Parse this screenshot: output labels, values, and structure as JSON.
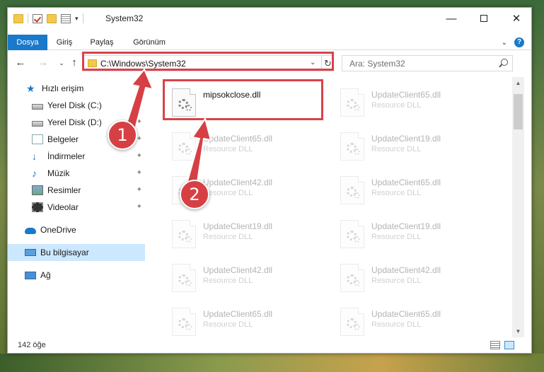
{
  "window": {
    "title": "System32",
    "qat_dropdown": "▾",
    "controls": {
      "minimize": "—",
      "maximize": "",
      "close": "✕"
    }
  },
  "ribbon": {
    "tabs": [
      "Dosya",
      "Giriş",
      "Paylaş",
      "Görünüm"
    ],
    "collapse": "⌄",
    "help": "?",
    "active_color": "#1979ca"
  },
  "nav": {
    "back": "←",
    "forward": "→",
    "recent": "⌄",
    "up": "↑",
    "address": "C:\\Windows\\System32",
    "address_dropdown": "⌄",
    "refresh": "↻",
    "search_placeholder": "Ara: System32"
  },
  "sidebar": {
    "items": [
      {
        "label": "Hızlı erişim",
        "icon": "star-icon",
        "pinned": false
      },
      {
        "label": "Yerel Disk (C:)",
        "icon": "drive-icon",
        "pinned": true
      },
      {
        "label": "Yerel Disk (D:)",
        "icon": "drive-icon",
        "pinned": true
      },
      {
        "label": "Belgeler",
        "icon": "documents-icon",
        "pinned": true
      },
      {
        "label": "İndirmeler",
        "icon": "downloads-icon",
        "pinned": true
      },
      {
        "label": "Müzik",
        "icon": "music-icon",
        "pinned": true
      },
      {
        "label": "Resimler",
        "icon": "pictures-icon",
        "pinned": true
      },
      {
        "label": "Videolar",
        "icon": "videos-icon",
        "pinned": true
      },
      {
        "label": "OneDrive",
        "icon": "onedrive-icon",
        "pinned": false
      },
      {
        "label": "Bu bilgisayar",
        "icon": "this-pc-icon",
        "pinned": false,
        "selected": true
      },
      {
        "label": "Ağ",
        "icon": "network-icon",
        "pinned": false
      }
    ],
    "pin_glyph": "📌"
  },
  "files": [
    {
      "name": "mipsokclose.dll",
      "subtitle": "",
      "highlighted": true
    },
    {
      "name": "UpdateClient65.dll",
      "subtitle": "Resource DLL"
    },
    {
      "name": "UpdateClient65.dll",
      "subtitle": "Resource DLL"
    },
    {
      "name": "UpdateClient19.dll",
      "subtitle": "Resource DLL"
    },
    {
      "name": "UpdateClient42.dll",
      "subtitle": "Resource DLL"
    },
    {
      "name": "UpdateClient65.dll",
      "subtitle": "Resource DLL"
    },
    {
      "name": "UpdateClient19.dll",
      "subtitle": "Resource DLL"
    },
    {
      "name": "UpdateClient19.dll",
      "subtitle": "Resource DLL"
    },
    {
      "name": "UpdateClient42.dll",
      "subtitle": "Resource DLL"
    },
    {
      "name": "UpdateClient42.dll",
      "subtitle": "Resource DLL"
    },
    {
      "name": "UpdateClient65.dll",
      "subtitle": "Resource DLL"
    },
    {
      "name": "UpdateClient65.dll",
      "subtitle": "Resource DLL"
    }
  ],
  "status": {
    "count": "142 öğe"
  },
  "callouts": {
    "one": "1",
    "two": "2",
    "color": "#d64045"
  }
}
